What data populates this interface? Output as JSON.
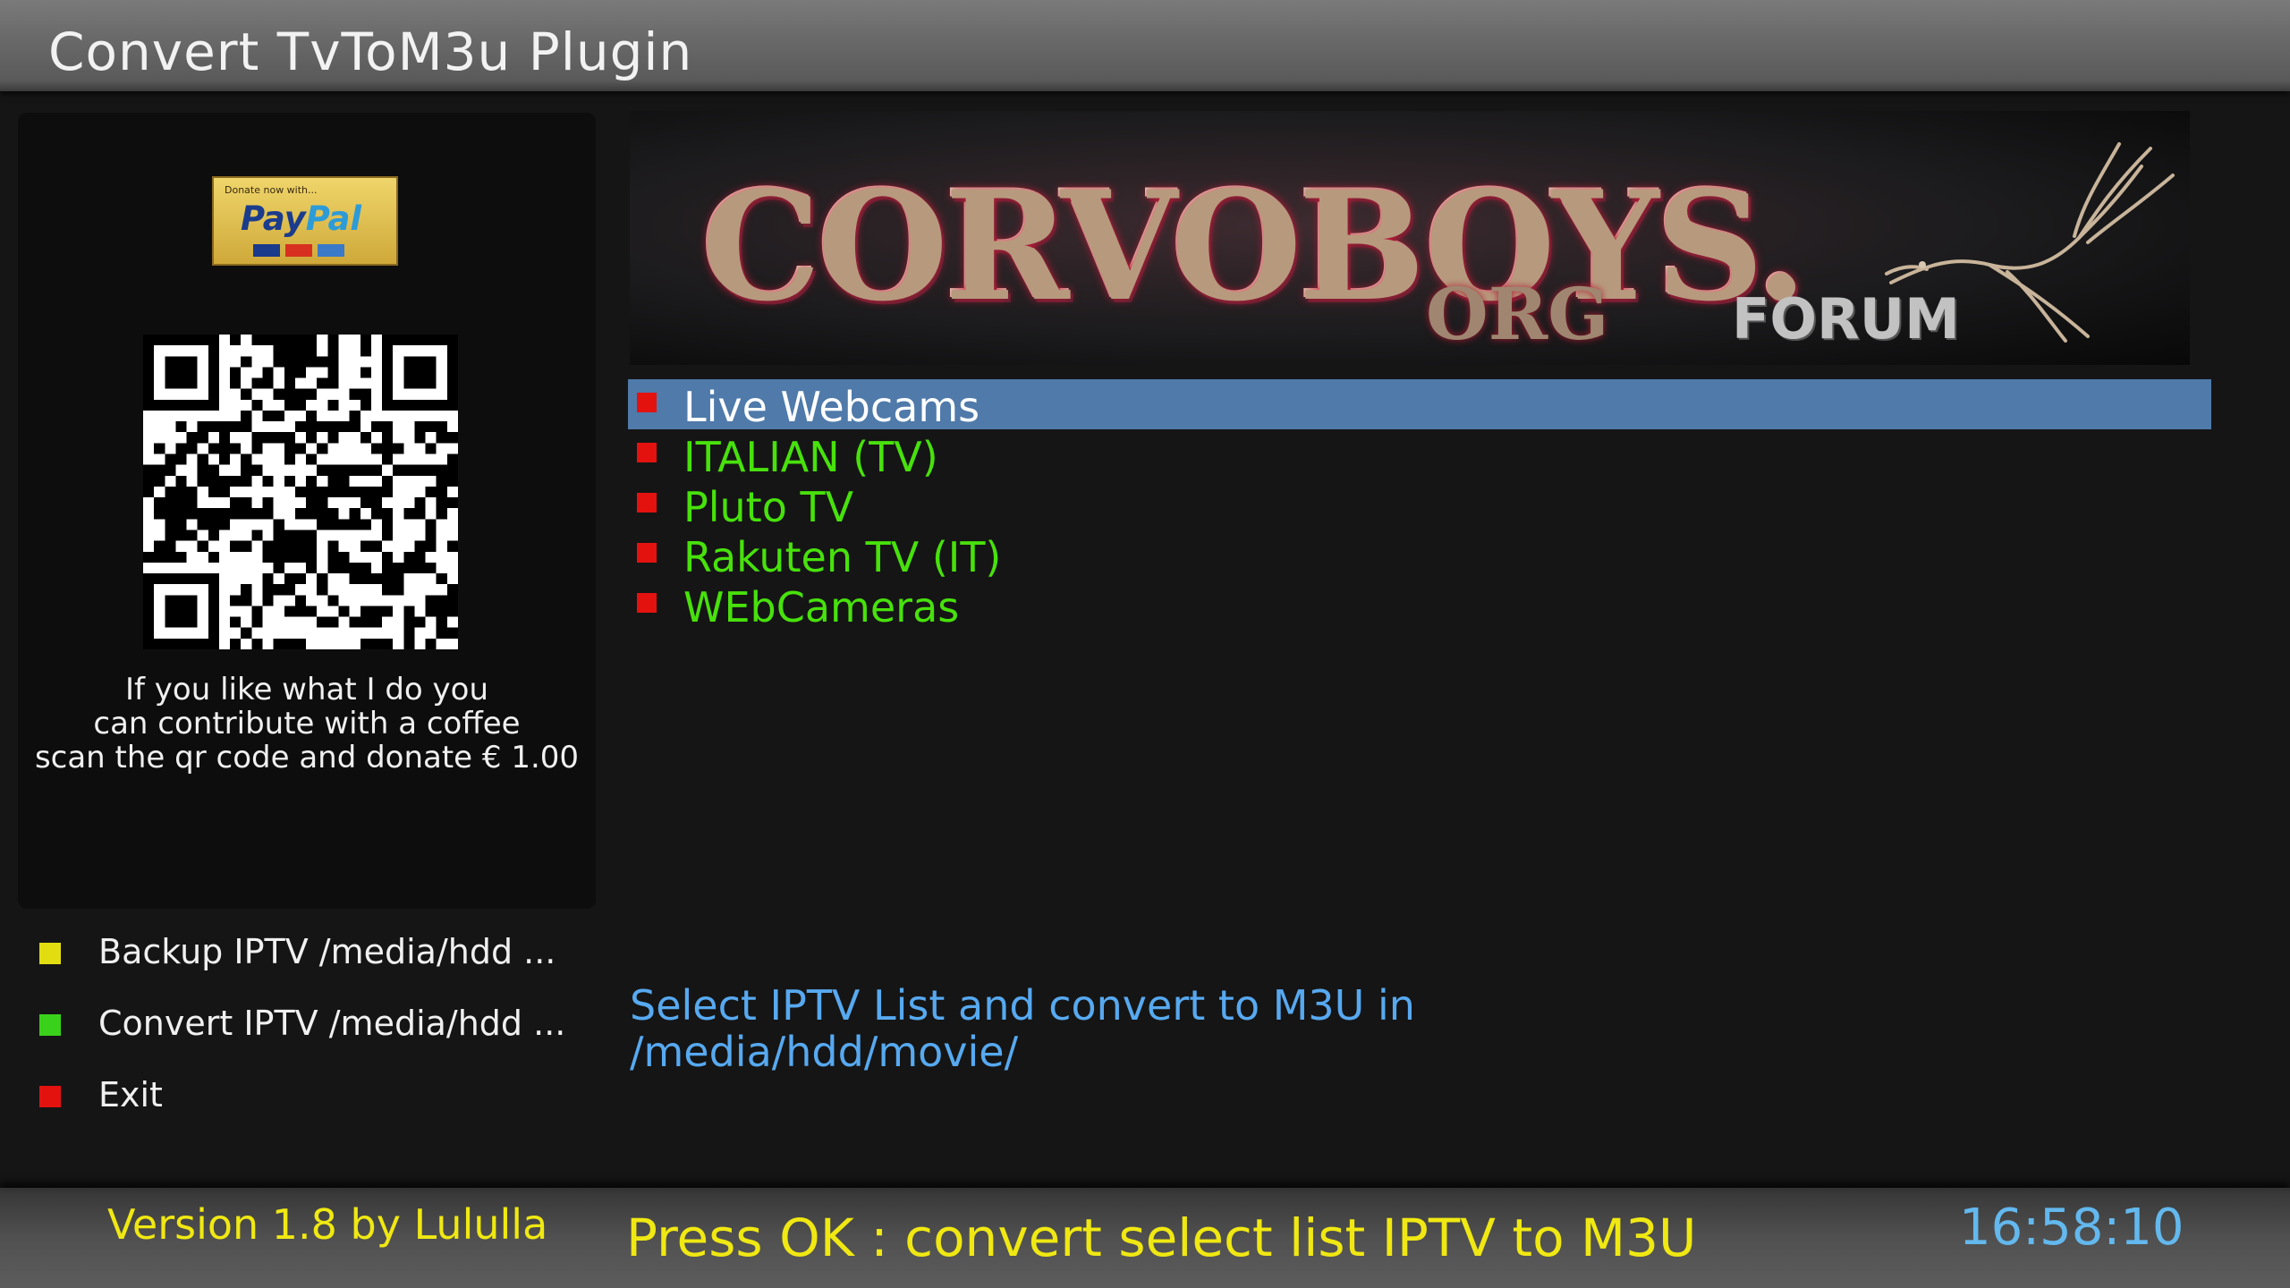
{
  "window": {
    "title": "Convert TvToM3u Plugin"
  },
  "donation": {
    "paypal": {
      "small_text": "Donate now with...",
      "brand_pay": "Pay",
      "brand_pal": "Pal"
    },
    "text_lines": [
      "If you like what I do you",
      "can contribute with a coffee",
      "scan the qr code and donate € 1.00"
    ]
  },
  "banner": {
    "brand": "CORVOBOYS.",
    "org": "ORG",
    "forum": "FORUM"
  },
  "menu": {
    "selected_index": 0,
    "bullet_color": "#e3120f",
    "text_color": "#48e10c",
    "selected_bg": "#4f7aaa",
    "items": [
      {
        "label": "Live Webcams"
      },
      {
        "label": "ITALIAN (TV)"
      },
      {
        "label": "Pluto TV"
      },
      {
        "label": "Rakuten TV (IT)"
      },
      {
        "label": "WEbCameras"
      }
    ]
  },
  "description": {
    "line1": "Select IPTV List and convert to M3U in",
    "line2": "/media/hdd/movie/"
  },
  "keys": [
    {
      "color": "yellow",
      "hex": "#e2dd10",
      "label": "Backup IPTV /media/hdd ..."
    },
    {
      "color": "green",
      "hex": "#3ad11b",
      "label": "Convert IPTV /media/hdd ..."
    },
    {
      "color": "red",
      "hex": "#e3120f",
      "label": "Exit"
    }
  ],
  "footer": {
    "version": "Version 1.8 by Lululla",
    "hint": "Press OK : convert select list IPTV to M3U",
    "clock": "16:58:10"
  }
}
